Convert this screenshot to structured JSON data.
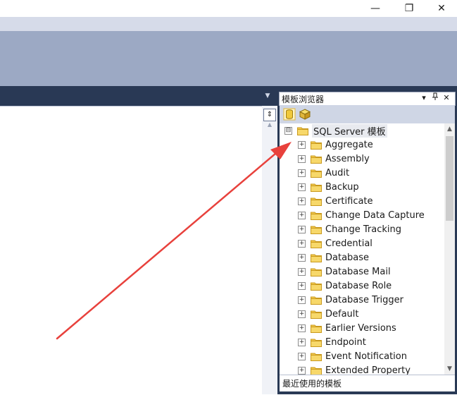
{
  "window": {
    "minimize_glyph": "—",
    "restore_glyph": "❐",
    "close_glyph": "✕"
  },
  "template_browser": {
    "title": "模板浏览器",
    "header_buttons": [
      "▾",
      "ᚁ",
      "✕"
    ],
    "toolbar_icons": [
      "database-cylinder-icon",
      "analysis-cube-icon"
    ],
    "root": {
      "label": "SQL Server 模板",
      "expander": "⊟"
    },
    "items": [
      {
        "label": "Aggregate"
      },
      {
        "label": "Assembly"
      },
      {
        "label": "Audit"
      },
      {
        "label": "Backup"
      },
      {
        "label": "Certificate"
      },
      {
        "label": "Change Data Capture"
      },
      {
        "label": "Change Tracking"
      },
      {
        "label": "Credential"
      },
      {
        "label": "Database"
      },
      {
        "label": "Database Mail"
      },
      {
        "label": "Database Role"
      },
      {
        "label": "Database Trigger"
      },
      {
        "label": "Default"
      },
      {
        "label": "Earlier Versions"
      },
      {
        "label": "Endpoint"
      },
      {
        "label": "Event Notification"
      },
      {
        "label": "Extended Property"
      }
    ],
    "recent_label": "最近使用的模板"
  },
  "colors": {
    "accent_dark": "#293955",
    "annotation_arrow": "#e8413c",
    "folder_yellow": "#f2c94c"
  }
}
